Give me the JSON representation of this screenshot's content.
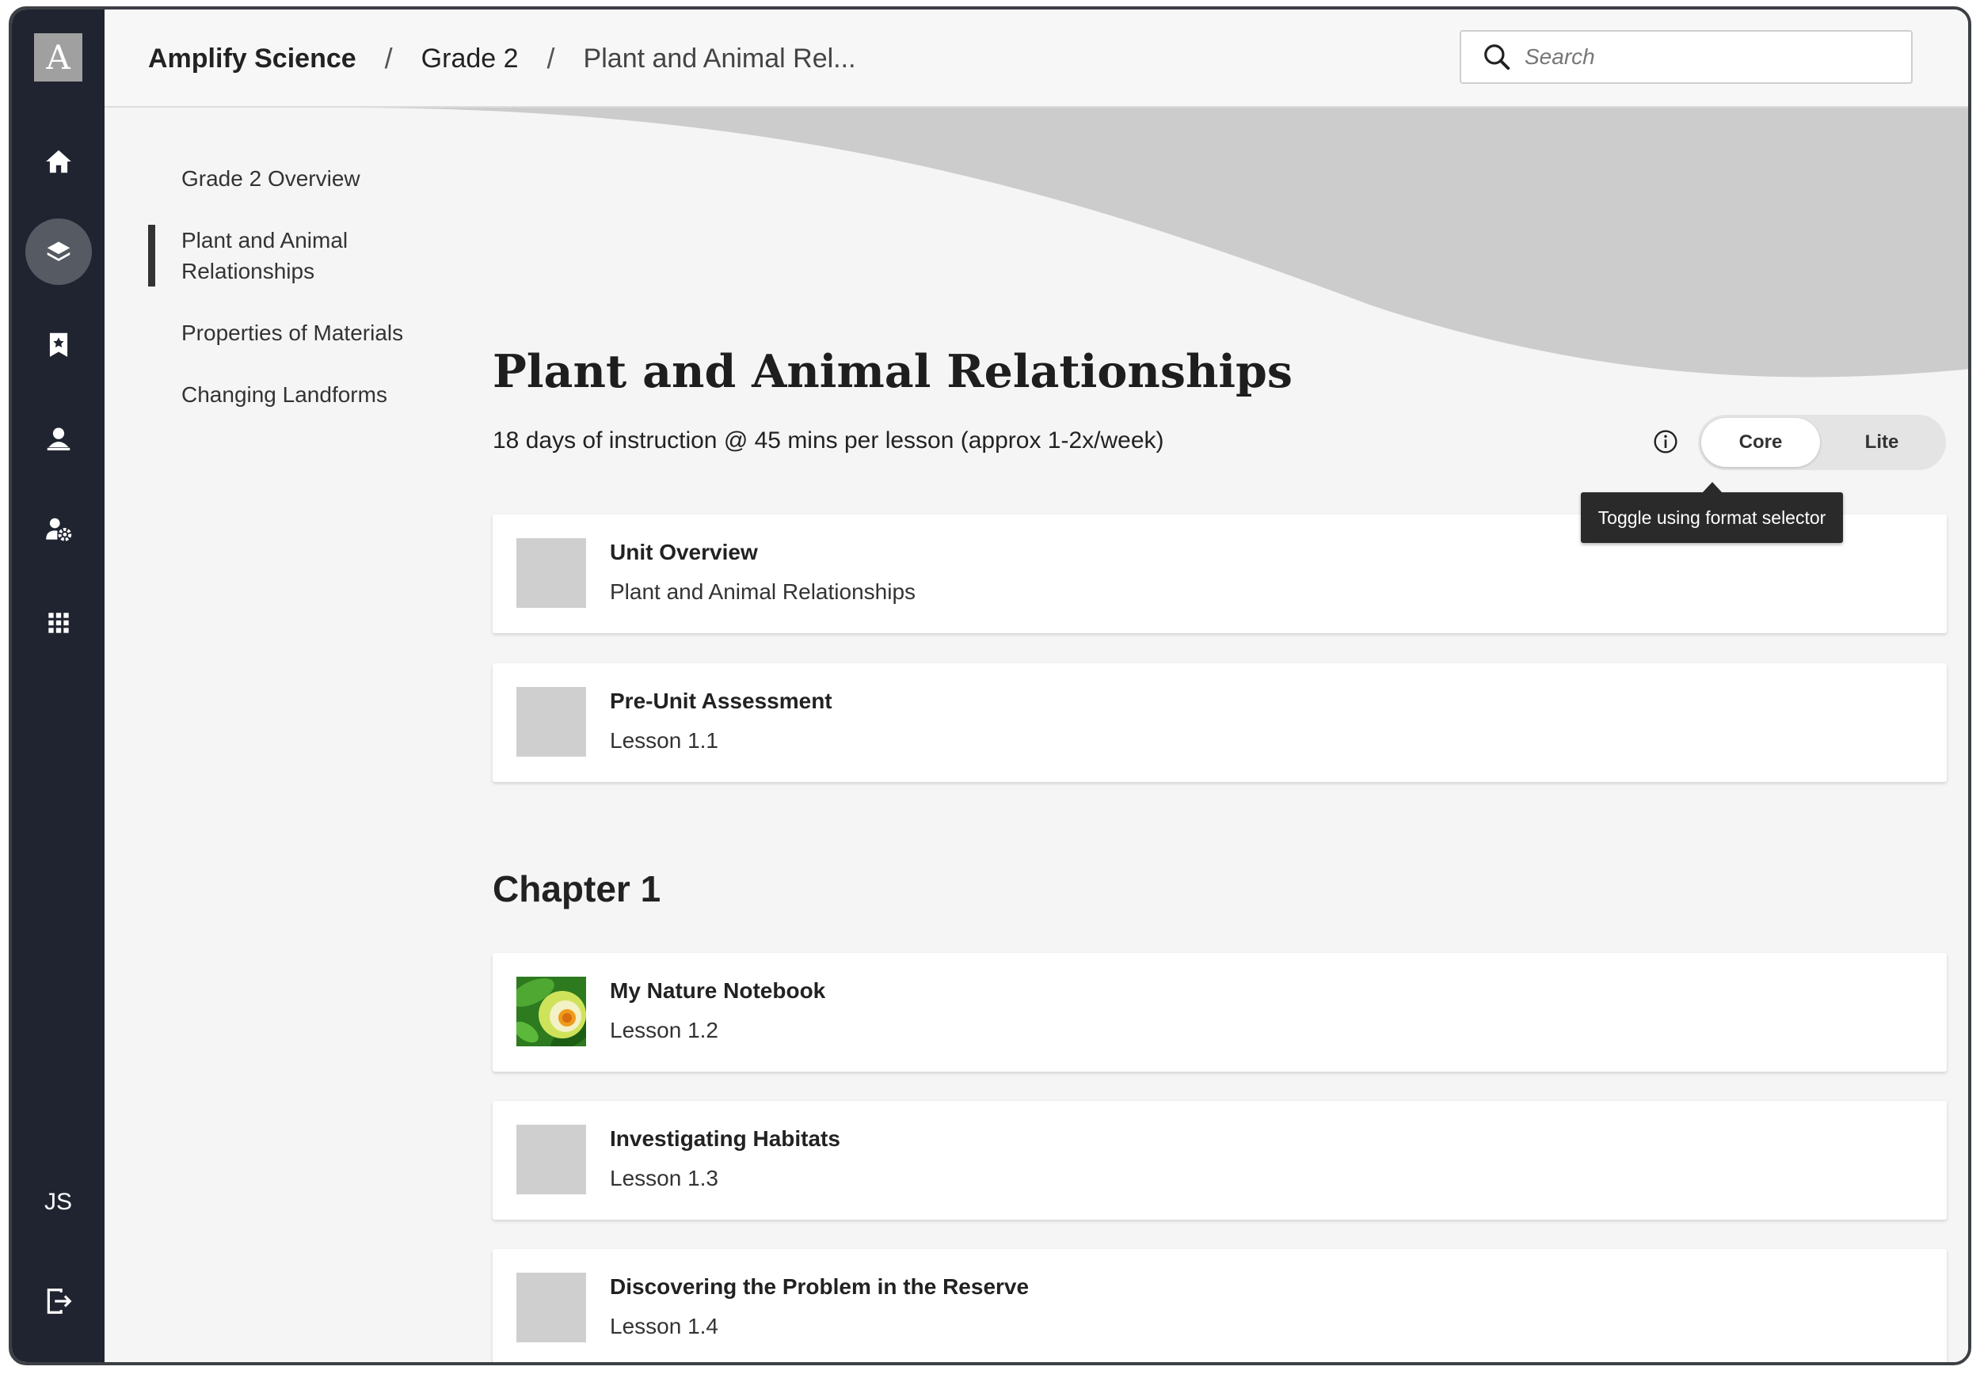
{
  "app": {
    "logo_letter": "A",
    "user_initials": "JS"
  },
  "sidebar": {
    "icons": [
      "home-icon",
      "layers-icon",
      "bookmark-icon",
      "teacher-icon",
      "user-settings-icon",
      "apps-grid-icon",
      "logout-icon"
    ]
  },
  "breadcrumb": {
    "items": [
      "Amplify Science",
      "Grade 2",
      "Plant and Animal Rel..."
    ],
    "separator": "/"
  },
  "search": {
    "placeholder": "Search"
  },
  "unit_nav": {
    "items": [
      {
        "label": "Grade 2 Overview",
        "active": false
      },
      {
        "label": "Plant and Animal Relationships",
        "active": true
      },
      {
        "label": "Properties of Materials",
        "active": false
      },
      {
        "label": "Changing Landforms",
        "active": false
      }
    ]
  },
  "unit": {
    "title": "Plant and Animal Relationships",
    "subtitle": "18 days of instruction @ 45 mins per lesson (approx 1-2x/week)"
  },
  "format_toggle": {
    "options": [
      "Core",
      "Lite"
    ],
    "selected": "Core",
    "tooltip": "Toggle using format selector"
  },
  "cards": [
    {
      "title": "Unit Overview",
      "subtitle": "Plant and Animal Relationships",
      "image": "placeholder"
    },
    {
      "title": "Pre-Unit Assessment",
      "subtitle": "Lesson 1.1",
      "image": "placeholder"
    }
  ],
  "chapter": {
    "title": "Chapter 1",
    "lessons": [
      {
        "title": "My Nature Notebook",
        "subtitle": "Lesson 1.2",
        "image": "nature-notebook-thumbnail"
      },
      {
        "title": "Investigating Habitats",
        "subtitle": "Lesson 1.3",
        "image": "placeholder"
      },
      {
        "title": "Discovering the Problem in the Reserve",
        "subtitle": "Lesson 1.4",
        "image": "placeholder"
      }
    ]
  },
  "colors": {
    "sidebar_bg": "#1f2430",
    "page_bg": "#f5f5f5",
    "wave": "#cccccc",
    "tooltip_bg": "#2a2a2a"
  }
}
